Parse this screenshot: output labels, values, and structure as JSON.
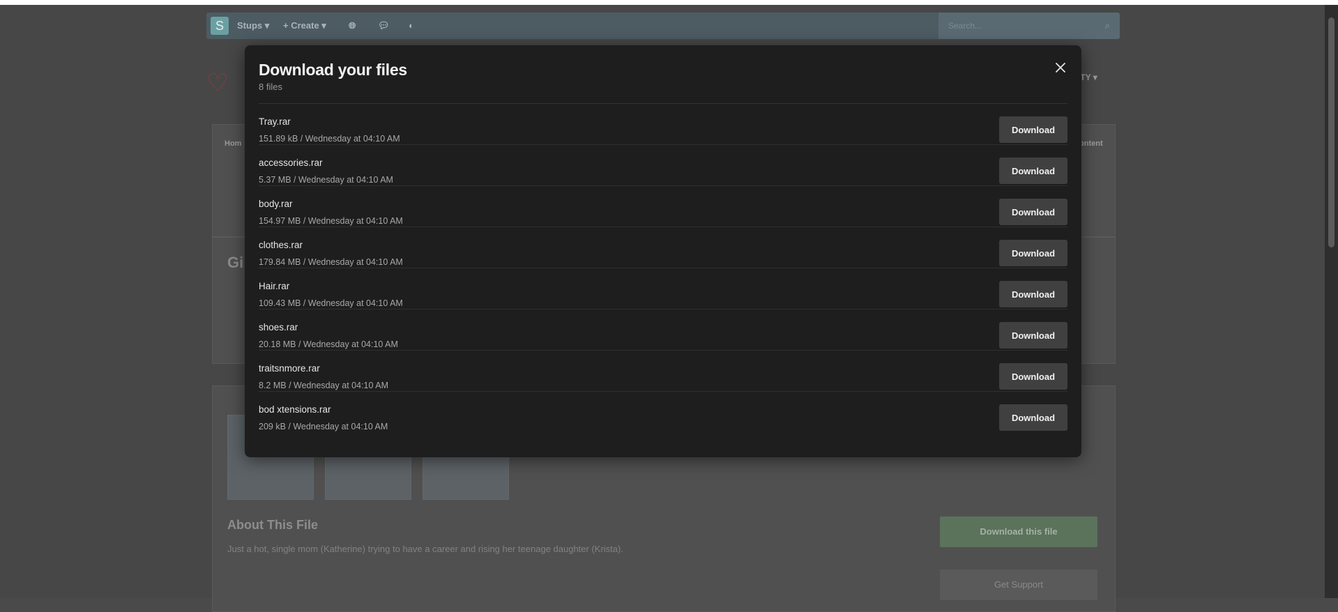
{
  "navbar": {
    "logo_letter": "S",
    "items": [
      {
        "label": "Stups ▾"
      },
      {
        "label": "+ Create ▾"
      }
    ],
    "search_placeholder": "Search..."
  },
  "background": {
    "community_label": "ITY ▾",
    "crumb_left": "Hom",
    "crumb_right": "ontent",
    "title_fragment": "Gi",
    "about_title": "About This File",
    "about_desc": "Just a hot, single mom (Katherine) trying to have a career and rising her teenage daughter (Krista).",
    "download_file_label": "Download this file",
    "get_support_label": "Get Support"
  },
  "modal": {
    "title": "Download your files",
    "count": "8 files",
    "download_label": "Download",
    "files": [
      {
        "name": "Tray.rar",
        "meta": "151.89 kB / Wednesday at 04:10 AM"
      },
      {
        "name": "accessories.rar",
        "meta": "5.37 MB / Wednesday at 04:10 AM"
      },
      {
        "name": "body.rar",
        "meta": "154.97 MB / Wednesday at 04:10 AM"
      },
      {
        "name": "clothes.rar",
        "meta": "179.84 MB / Wednesday at 04:10 AM"
      },
      {
        "name": "Hair.rar",
        "meta": "109.43 MB / Wednesday at 04:10 AM"
      },
      {
        "name": "shoes.rar",
        "meta": "20.18 MB / Wednesday at 04:10 AM"
      },
      {
        "name": "traitsnmore.rar",
        "meta": "8.2 MB / Wednesday at 04:10 AM"
      },
      {
        "name": "bod xtensions.rar",
        "meta": "209 kB / Wednesday at 04:10 AM"
      }
    ]
  }
}
